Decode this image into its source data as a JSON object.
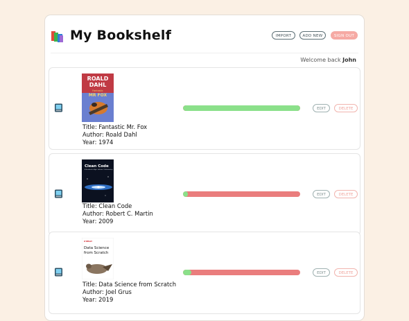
{
  "header": {
    "title": "My Bookshelf",
    "icon": "books-icon",
    "buttons": {
      "import": "IMPORT",
      "add_new": "ADD NEW",
      "sign_out": "SIGN OUT"
    }
  },
  "welcome": {
    "prefix": "Welcome back",
    "user": "John"
  },
  "books": [
    {
      "title_line": "Title: Fantastic Mr. Fox",
      "author_line": "Author: Roald Dahl",
      "year_line": "Year: 1974",
      "progress": 1.0,
      "edit": "EDIT",
      "delete": "DELETE",
      "cover_text": [
        "ROALD",
        "DAHL",
        "Fantastic",
        "MR FOX"
      ]
    },
    {
      "title_line": "Title: Clean Code",
      "author_line": "Author: Robert C. Martin",
      "year_line": "Year: 2009",
      "progress": 0.04,
      "edit": "EDIT",
      "delete": "DELETE",
      "cover_text": [
        "Clean Code",
        "A Handbook of Agile Software Craftsmanship"
      ]
    },
    {
      "title_line": "Title: Data Science from Scratch",
      "author_line": "Author: Joel Grus",
      "year_line": "Year: 2019",
      "progress": 0.07,
      "edit": "EDIT",
      "delete": "DELETE",
      "cover_text": [
        "O'REILLY",
        "Data Science",
        "from Scratch"
      ]
    }
  ],
  "colors": {
    "progress_done": "#8be08a",
    "progress_remaining": "#ea7d7d",
    "signout": "#f6aaa4",
    "background": "#fbf0e4"
  }
}
